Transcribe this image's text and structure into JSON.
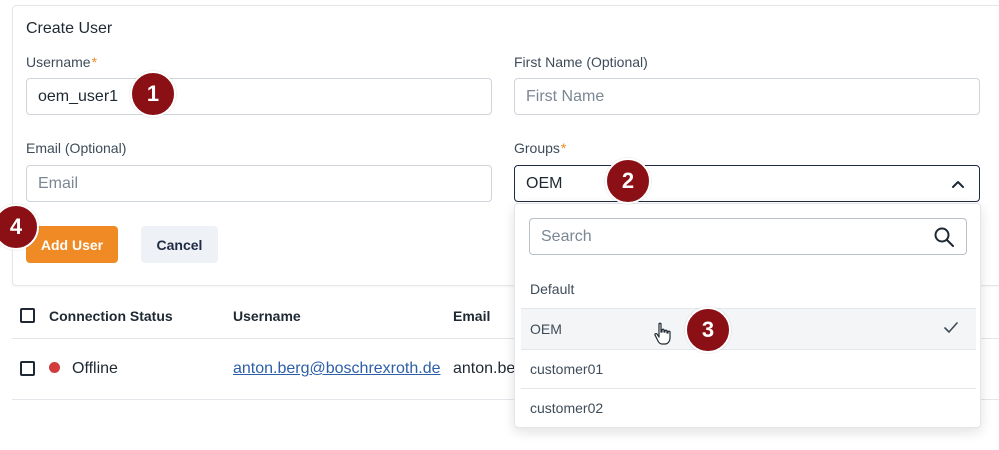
{
  "form": {
    "title": "Create User",
    "username": {
      "label": "Username",
      "required_mark": "*",
      "value": "oem_user1"
    },
    "first_name": {
      "label": "First Name (Optional)",
      "placeholder": "First Name"
    },
    "email": {
      "label": "Email (Optional)",
      "placeholder": "Email"
    },
    "groups": {
      "label": "Groups",
      "required_mark": "*",
      "value": "OEM"
    },
    "add_button": "Add User",
    "cancel_button": "Cancel"
  },
  "dropdown": {
    "search_placeholder": "Search",
    "options": [
      "Default",
      "OEM",
      "customer01",
      "customer02"
    ],
    "selected": "OEM"
  },
  "table": {
    "headers": [
      "Connection Status",
      "Username",
      "Email"
    ],
    "rows": [
      {
        "status": "Offline",
        "username": "anton.berg@boschrexroth.de",
        "email": "anton.be"
      }
    ]
  },
  "callouts": [
    "1",
    "2",
    "3",
    "4"
  ],
  "colors": {
    "accent": "#f08a24",
    "callout": "#8b1015",
    "status_offline": "#d13b3b",
    "link": "#2d5ea8"
  }
}
